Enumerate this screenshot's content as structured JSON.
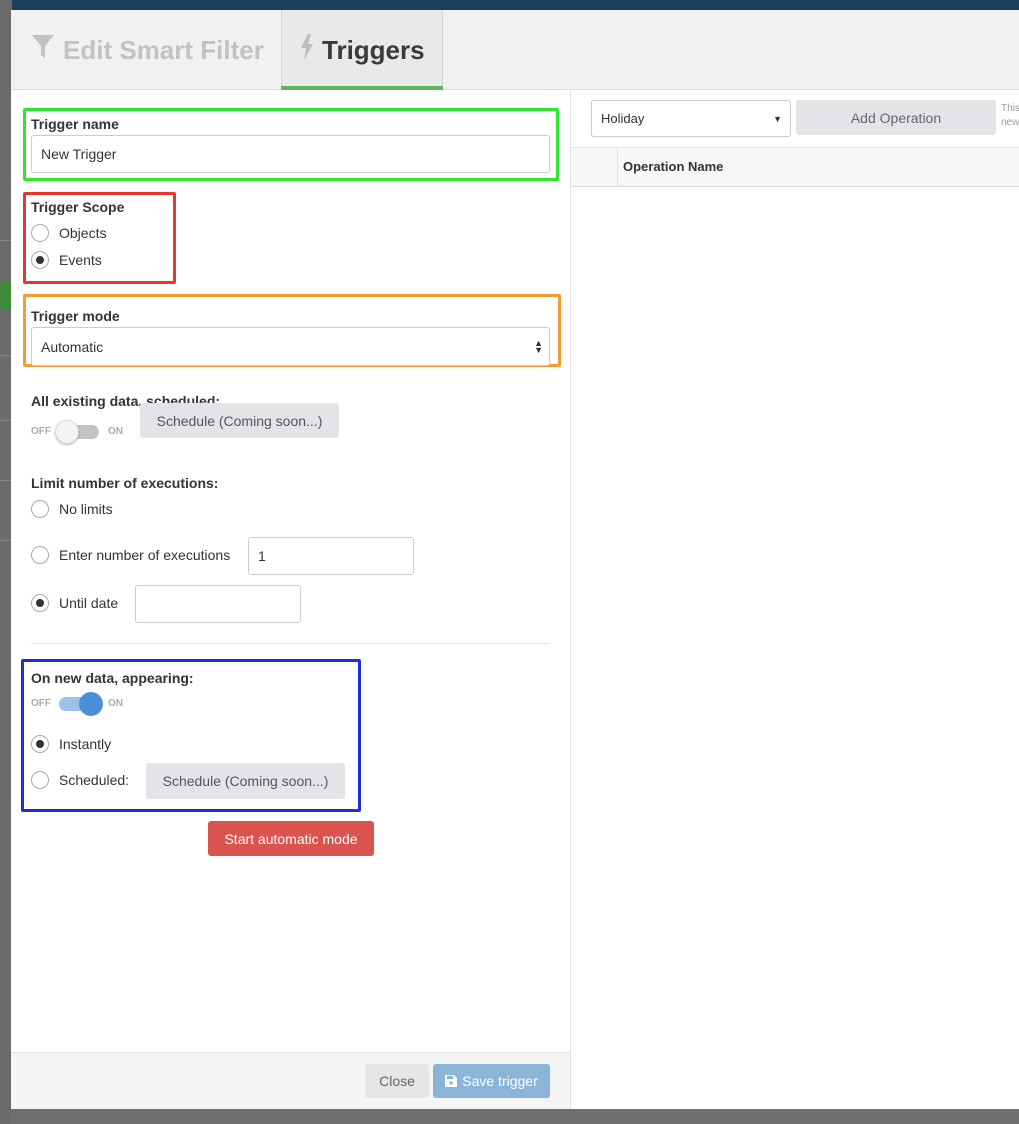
{
  "tabs": {
    "edit_smart_filter": "Edit Smart Filter",
    "triggers": "Triggers"
  },
  "trigger_name": {
    "label": "Trigger name",
    "value": "New Trigger"
  },
  "trigger_scope": {
    "label": "Trigger Scope",
    "options": [
      "Objects",
      "Events"
    ],
    "selected": "Events"
  },
  "trigger_mode": {
    "label": "Trigger mode",
    "value": "Automatic"
  },
  "existing_data": {
    "label": "All existing data, scheduled:",
    "toggle_off": "OFF",
    "toggle_on": "ON",
    "toggle_state": "off",
    "schedule_button": "Schedule (Coming soon...)"
  },
  "limit": {
    "label": "Limit number of executions:",
    "no_limits": "No limits",
    "enter_number": "Enter number of executions",
    "number_value": "1",
    "until_date": "Until date",
    "selected": "Until date"
  },
  "new_data": {
    "label": "On new data, appearing:",
    "toggle_off": "OFF",
    "toggle_on": "ON",
    "toggle_state": "on",
    "instantly": "Instantly",
    "scheduled": "Scheduled:",
    "schedule_button": "Schedule (Coming soon...)",
    "selected": "Instantly"
  },
  "start_button": "Start automatic mode",
  "footer": {
    "close": "Close",
    "save": "Save trigger"
  },
  "right": {
    "operation_select": "Holiday",
    "add_operation": "Add Operation",
    "hint_line1": "This",
    "hint_line2": "new",
    "column_header": "Operation Name"
  },
  "colors": {
    "highlight_green": "#2ee82e",
    "highlight_red": "#e8352e",
    "highlight_orange": "#f59a2c",
    "highlight_blue": "#1c2fe0",
    "start_button": "#d9534f",
    "save_button": "#8ab4d8",
    "toggle_on": "#4a8fd8",
    "tab_active_bar": "#5cb85c"
  }
}
